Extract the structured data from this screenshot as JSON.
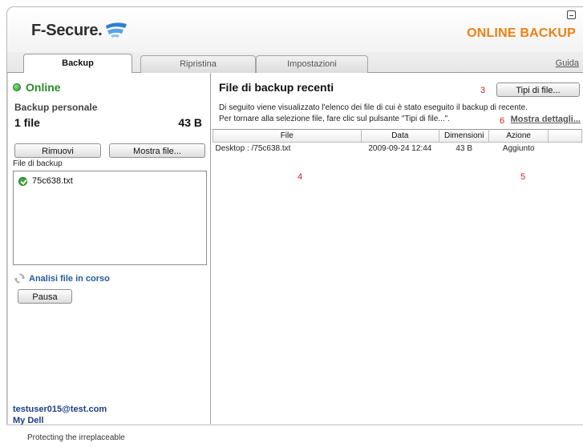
{
  "header": {
    "logo_text": "F-Secure.",
    "product_title": "ONLINE BACKUP"
  },
  "tabs": [
    {
      "label": "Backup",
      "active": true
    },
    {
      "label": "Ripristina",
      "active": false
    },
    {
      "label": "Impostazioni",
      "active": false
    }
  ],
  "help_link": "Guida",
  "left": {
    "status": "Online",
    "section_label": "Backup personale",
    "file_count": "1 file",
    "total_size": "43 B",
    "remove_button": "Rimuovi",
    "show_files_button": "Mostra file...",
    "list_label": "File di backup",
    "files": [
      "75c638.txt"
    ],
    "analysis_text": "Analisi file in corso",
    "pause_button": "Pausa",
    "user_email": "testuser015@test.com",
    "device_name": "My Dell"
  },
  "main": {
    "title": "File di backup recenti",
    "marker_3": "3",
    "file_types_button": "Tipi di file...",
    "description_line1": "Di seguito viene visualizzato l'elenco dei file di cui è stato eseguito il backup di recente.",
    "description_line2": "Per tornare alla selezione file, fare clic sul pulsante \"Tipi di file...\".",
    "marker_6": "6",
    "details_link": "Mostra dettagli...",
    "table": {
      "columns": [
        "File",
        "Data",
        "Dimensioni",
        "Azione"
      ],
      "rows": [
        {
          "file": "Desktop : /75c638.txt",
          "date": "2009-09-24 12:44",
          "size": "43 B",
          "action": "Aggiunto"
        }
      ]
    },
    "marker_4": "4",
    "marker_5": "5"
  },
  "footer": "Protecting the irreplaceable",
  "colors": {
    "brand_orange": "#f07f12",
    "online_green": "#2a8a2a",
    "link_blue": "#1c3e86",
    "marker_red": "#d32020"
  }
}
